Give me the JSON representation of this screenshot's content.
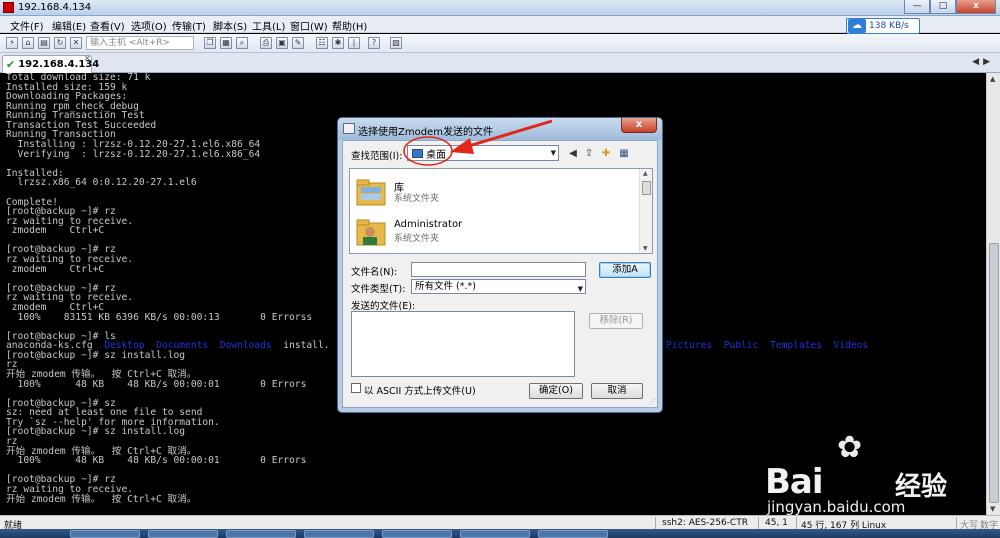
{
  "window": {
    "title": "192.168.4.134",
    "controls": [
      "—",
      "□",
      "x"
    ]
  },
  "menu": {
    "items": [
      "文件(F)",
      "编辑(E)",
      "查看(V)",
      "选项(O)",
      "传输(T)",
      "脚本(S)",
      "工具(L)",
      "窗口(W)",
      "帮助(H)"
    ],
    "net_speed": "138 KB/s"
  },
  "toolbar": {
    "host_placeholder": "输入主机 <Alt+R>"
  },
  "tab": {
    "label": "192.168.4.134"
  },
  "terminal": {
    "lines": [
      "Total download size: 71 k",
      "Installed size: 159 k",
      "Downloading Packages:",
      "Running rpm_check_debug",
      "Running Transaction Test",
      "Transaction Test Succeeded",
      "Running Transaction",
      "  Installing : lrzsz-0.12.20-27.1.el6.x86_64",
      "  Verifying  : lrzsz-0.12.20-27.1.el6.x86_64",
      "",
      "Installed:",
      "  lrzsz.x86_64 0:0.12.20-27.1.el6",
      "",
      "Complete!",
      "[root@backup ~]# rz",
      "rz waiting to receive.",
      " zmodem    Ctrl+C",
      "",
      "[root@backup ~]# rz",
      "rz waiting to receive.",
      " zmodem    Ctrl+C",
      "",
      "[root@backup ~]# rz",
      "rz waiting to receive.",
      " zmodem    Ctrl+C",
      "  100%    83151 KB 6396 KB/s 00:00:13       0 Errorss",
      "",
      "[root@backup ~]# ls",
      "",
      "[root@backup ~]# sz install.log",
      "rz",
      "开始 zmodem 传输。  按 Ctrl+C 取消。",
      "  100%      48 KB    48 KB/s 00:00:01       0 Errors",
      "",
      "[root@backup ~]# sz",
      "sz: need at least one file to send",
      "Try `sz --help' for more information.",
      "[root@backup ~]# sz install.log",
      "rz",
      "开始 zmodem 传输。  按 Ctrl+C 取消。",
      "  100%      48 KB    48 KB/s 00:00:01       0 Errors",
      "",
      "[root@backup ~]# rz",
      "rz waiting to receive.",
      "开始 zmodem 传输。  按 Ctrl+C 取消。"
    ],
    "ls_output": {
      "plain_start": "anaconda-ks.cfg",
      "dir1": "Desktop",
      "dir2": "Documents",
      "dir3": "Downloads",
      "plain_mid": "install.",
      "dir4": "Pictures",
      "dir5": "Public",
      "dir6": "Templates",
      "dir7": "Videos"
    }
  },
  "dialog": {
    "title": "选择使用Zmodem发送的文件",
    "close": "x",
    "look_in_label": "查找范围(I):",
    "look_in_value": "桌面",
    "files": [
      {
        "name": "库",
        "type": "系统文件夹"
      },
      {
        "name": "Administrator",
        "type": "系统文件夹"
      }
    ],
    "filename_label": "文件名(N):",
    "filename_value": "",
    "add_button": "添加A",
    "filetype_label": "文件类型(T):",
    "filetype_value": "所有文件 (*.*)",
    "sent_files_label": "发送的文件(E):",
    "remove_button": "移除(R)",
    "ascii_checkbox_label": "以 ASCII 方式上传文件(U)",
    "ascii_checked": false,
    "ok_button": "确定(O)",
    "cancel_button": "取消"
  },
  "status": {
    "ready": "就绪",
    "cipher": "ssh2: AES-256-CTR",
    "position": "45,  1",
    "size": "45 行, 167 列 Linux",
    "caps": "大写",
    "num": "数字"
  },
  "watermark": {
    "brand": "Bai",
    "brand_cn": "经验",
    "url": "jingyan.baidu.com"
  },
  "colors": {
    "terminal_bg": "#000000",
    "terminal_fg": "#c8c8c8",
    "ls_dir": "#1a35d8",
    "annotation": "#e0271c"
  }
}
